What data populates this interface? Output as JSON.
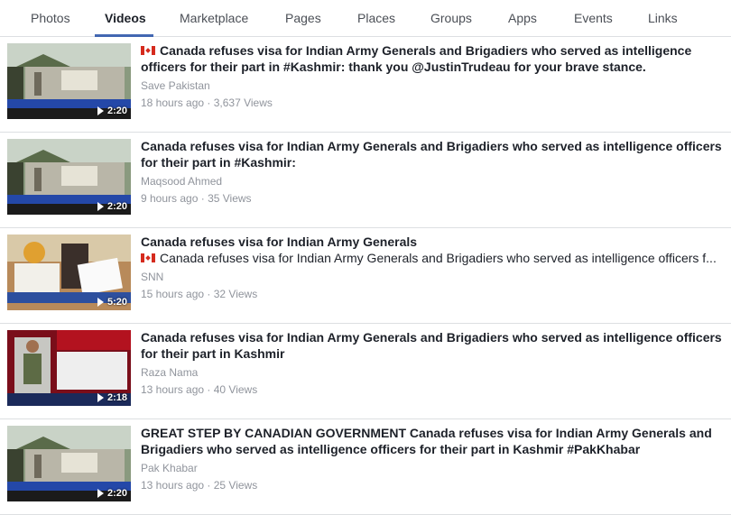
{
  "tabs": [
    "Photos",
    "Videos",
    "Marketplace",
    "Pages",
    "Places",
    "Groups",
    "Apps",
    "Events",
    "Links"
  ],
  "active_tab": "Videos",
  "results": [
    {
      "title": "Canada refuses visa for Indian Army Generals and Brigadiers who served as intelligence officers for their part in #Kashmir: thank you @JustinTrudeau for your brave stance.",
      "title_flag": true,
      "description": "",
      "author": "Save Pakistan",
      "time": "18 hours ago",
      "views": "3,637 Views",
      "duration": "2:20",
      "thumb_caption": "CANADA INSULTS INDIA AGAIN",
      "thumb_corner": "HEADLINES"
    },
    {
      "title": "Canada refuses visa for Indian Army Generals and Brigadiers who served as intelligence officers for their part in #Kashmir:",
      "title_flag": false,
      "description": "",
      "author": "Maqsood Ahmed",
      "time": "9 hours ago",
      "views": "35 Views",
      "duration": "2:20",
      "thumb_caption": "CANADA INSULTS INDIA AGAIN",
      "thumb_corner": "HEADLINES"
    },
    {
      "title": "Canada refuses visa for Indian Army Generals",
      "title_flag": false,
      "description": "Canada refuses visa for Indian Army Generals and Brigadiers who served as intelligence officers f...",
      "description_flag": true,
      "author": "SNN",
      "time": "15 hours ago",
      "views": "32 Views",
      "duration": "5:20",
      "thumb_caption": "FORMER GENERAL IB OFFICE DENIED VISA",
      "thumb_corner": ""
    },
    {
      "title": "Canada refuses visa for Indian Army Generals and Brigadiers who served as intelligence officers for their part in Kashmir",
      "title_flag": false,
      "description": "",
      "author": "Raza Nama",
      "time": "13 hours ago",
      "views": "40 Views",
      "duration": "2:18",
      "thumb_caption": "CANADA INSULTS INDIA AGAIN",
      "thumb_corner": ""
    },
    {
      "title": "GREAT STEP BY CANADIAN GOVERNMENT Canada refuses visa for Indian Army Generals and Brigadiers who served as intelligence officers for their part in Kashmir #PakKhabar",
      "title_flag": false,
      "description": "",
      "author": "Pak Khabar",
      "time": "13 hours ago",
      "views": "25 Views",
      "duration": "2:20",
      "thumb_caption": "CANADA INSULTS INDIA AGAIN",
      "thumb_corner": "HEADLINES"
    }
  ],
  "meta_separator": " · ",
  "colors": {
    "accent": "#4267b2",
    "secondary_text": "#90949c",
    "divider": "#dddfe2"
  }
}
